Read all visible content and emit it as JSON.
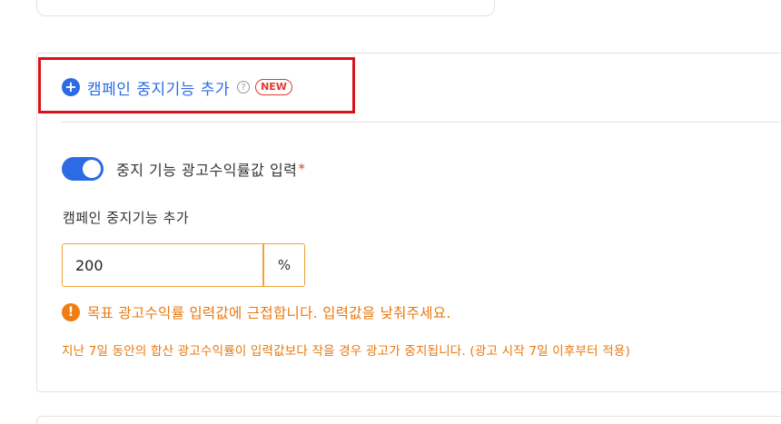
{
  "stop_section": {
    "add_label": "캠페인 중지기능 추가",
    "help_icon_glyph": "?",
    "new_badge": "NEW",
    "toggle": {
      "on": true,
      "label": "중지 기능 광고수익률값 입력",
      "required_mark": "*"
    },
    "field_label": "캠페인 중지기능 추가",
    "input_value": "200",
    "unit": "%",
    "warning_icon_glyph": "!",
    "warning": "목표 광고수익률 입력값에 근접합니다. 입력값을 낮춰주세요.",
    "help_text": "지난 7일 동안의 합산 광고수익률이 입력값보다 작을 경우 광고가 중지됩니다. (광고 시작 7일 이후부터 적용)"
  },
  "colors": {
    "accent": "#2d6be4",
    "warning": "#e8780f",
    "highlight_border": "#d8121a",
    "input_border": "#f0a33a"
  }
}
